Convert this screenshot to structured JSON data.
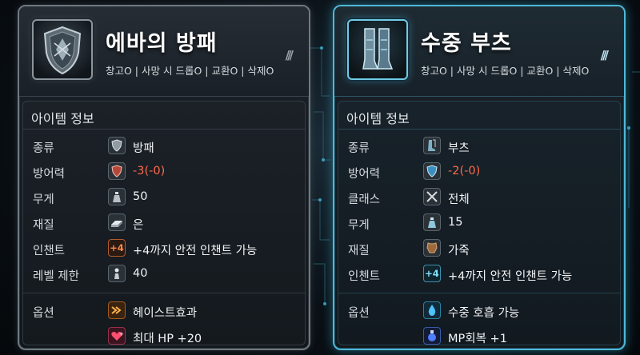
{
  "items": [
    {
      "name": "에바의 방패",
      "flags": "창고O | 사망 시 드롭O | 교환O | 삭제O",
      "section_title": "아이템 정보",
      "stats": [
        {
          "label": "종류",
          "value": "방패",
          "icon": "shield-icon",
          "negative": false
        },
        {
          "label": "방어력",
          "value": "-3(-0)",
          "icon": "shield-red-icon",
          "negative": true
        },
        {
          "label": "무게",
          "value": "50",
          "icon": "weight-icon",
          "negative": false
        },
        {
          "label": "재질",
          "value": "은",
          "icon": "silver-ingot-icon",
          "negative": false
        },
        {
          "label": "인챈트",
          "value": "+4까지 안전 인챈트 가능",
          "badge": "+4",
          "negative": false
        },
        {
          "label": "레벨 제한",
          "value": "40",
          "icon": "level-figure-icon",
          "negative": false
        }
      ],
      "options_label": "옵션",
      "options": [
        {
          "value": "헤이스트효과",
          "icon": "haste-arrow-icon"
        },
        {
          "value": "최대 HP +20",
          "icon": "heart-icon"
        }
      ]
    },
    {
      "name": "수중 부츠",
      "flags": "창고O | 사망 시 드롭O | 교환O | 삭제O",
      "section_title": "아이템 정보",
      "stats": [
        {
          "label": "종류",
          "value": "부츠",
          "icon": "boots-icon",
          "negative": false
        },
        {
          "label": "방어력",
          "value": "-2(-0)",
          "icon": "shield-blue-icon",
          "negative": true
        },
        {
          "label": "클래스",
          "value": "전체",
          "icon": "crossed-swords-icon",
          "negative": false
        },
        {
          "label": "무게",
          "value": "15",
          "icon": "weight-icon",
          "negative": false
        },
        {
          "label": "재질",
          "value": "가죽",
          "icon": "leather-icon",
          "negative": false
        },
        {
          "label": "인첸트",
          "value": "+4까지 안전 인챈트 가능",
          "badge": "+4",
          "negative": false
        }
      ],
      "options_label": "옵션",
      "options": [
        {
          "value": "수중 호흡 가능",
          "icon": "water-drop-icon"
        },
        {
          "value": "MP회복 +1",
          "icon": "mana-potion-icon"
        }
      ]
    }
  ],
  "colors": {
    "negative": "#ff6a4d",
    "right_accent": "#4fb8d8",
    "left_accent": "#6f7a82"
  }
}
